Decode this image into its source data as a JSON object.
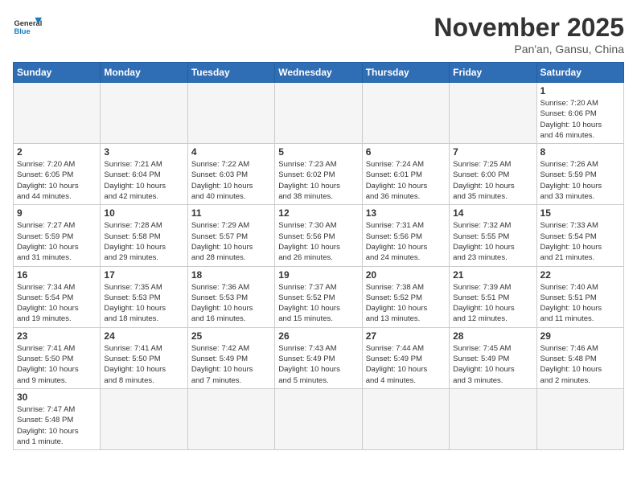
{
  "logo": {
    "general": "General",
    "blue": "Blue"
  },
  "title": "November 2025",
  "location": "Pan'an, Gansu, China",
  "weekdays": [
    "Sunday",
    "Monday",
    "Tuesday",
    "Wednesday",
    "Thursday",
    "Friday",
    "Saturday"
  ],
  "weeks": [
    [
      {
        "day": "",
        "info": ""
      },
      {
        "day": "",
        "info": ""
      },
      {
        "day": "",
        "info": ""
      },
      {
        "day": "",
        "info": ""
      },
      {
        "day": "",
        "info": ""
      },
      {
        "day": "",
        "info": ""
      },
      {
        "day": "1",
        "info": "Sunrise: 7:20 AM\nSunset: 6:06 PM\nDaylight: 10 hours\nand 46 minutes."
      }
    ],
    [
      {
        "day": "2",
        "info": "Sunrise: 7:20 AM\nSunset: 6:05 PM\nDaylight: 10 hours\nand 44 minutes."
      },
      {
        "day": "3",
        "info": "Sunrise: 7:21 AM\nSunset: 6:04 PM\nDaylight: 10 hours\nand 42 minutes."
      },
      {
        "day": "4",
        "info": "Sunrise: 7:22 AM\nSunset: 6:03 PM\nDaylight: 10 hours\nand 40 minutes."
      },
      {
        "day": "5",
        "info": "Sunrise: 7:23 AM\nSunset: 6:02 PM\nDaylight: 10 hours\nand 38 minutes."
      },
      {
        "day": "6",
        "info": "Sunrise: 7:24 AM\nSunset: 6:01 PM\nDaylight: 10 hours\nand 36 minutes."
      },
      {
        "day": "7",
        "info": "Sunrise: 7:25 AM\nSunset: 6:00 PM\nDaylight: 10 hours\nand 35 minutes."
      },
      {
        "day": "8",
        "info": "Sunrise: 7:26 AM\nSunset: 5:59 PM\nDaylight: 10 hours\nand 33 minutes."
      }
    ],
    [
      {
        "day": "9",
        "info": "Sunrise: 7:27 AM\nSunset: 5:59 PM\nDaylight: 10 hours\nand 31 minutes."
      },
      {
        "day": "10",
        "info": "Sunrise: 7:28 AM\nSunset: 5:58 PM\nDaylight: 10 hours\nand 29 minutes."
      },
      {
        "day": "11",
        "info": "Sunrise: 7:29 AM\nSunset: 5:57 PM\nDaylight: 10 hours\nand 28 minutes."
      },
      {
        "day": "12",
        "info": "Sunrise: 7:30 AM\nSunset: 5:56 PM\nDaylight: 10 hours\nand 26 minutes."
      },
      {
        "day": "13",
        "info": "Sunrise: 7:31 AM\nSunset: 5:56 PM\nDaylight: 10 hours\nand 24 minutes."
      },
      {
        "day": "14",
        "info": "Sunrise: 7:32 AM\nSunset: 5:55 PM\nDaylight: 10 hours\nand 23 minutes."
      },
      {
        "day": "15",
        "info": "Sunrise: 7:33 AM\nSunset: 5:54 PM\nDaylight: 10 hours\nand 21 minutes."
      }
    ],
    [
      {
        "day": "16",
        "info": "Sunrise: 7:34 AM\nSunset: 5:54 PM\nDaylight: 10 hours\nand 19 minutes."
      },
      {
        "day": "17",
        "info": "Sunrise: 7:35 AM\nSunset: 5:53 PM\nDaylight: 10 hours\nand 18 minutes."
      },
      {
        "day": "18",
        "info": "Sunrise: 7:36 AM\nSunset: 5:53 PM\nDaylight: 10 hours\nand 16 minutes."
      },
      {
        "day": "19",
        "info": "Sunrise: 7:37 AM\nSunset: 5:52 PM\nDaylight: 10 hours\nand 15 minutes."
      },
      {
        "day": "20",
        "info": "Sunrise: 7:38 AM\nSunset: 5:52 PM\nDaylight: 10 hours\nand 13 minutes."
      },
      {
        "day": "21",
        "info": "Sunrise: 7:39 AM\nSunset: 5:51 PM\nDaylight: 10 hours\nand 12 minutes."
      },
      {
        "day": "22",
        "info": "Sunrise: 7:40 AM\nSunset: 5:51 PM\nDaylight: 10 hours\nand 11 minutes."
      }
    ],
    [
      {
        "day": "23",
        "info": "Sunrise: 7:41 AM\nSunset: 5:50 PM\nDaylight: 10 hours\nand 9 minutes."
      },
      {
        "day": "24",
        "info": "Sunrise: 7:41 AM\nSunset: 5:50 PM\nDaylight: 10 hours\nand 8 minutes."
      },
      {
        "day": "25",
        "info": "Sunrise: 7:42 AM\nSunset: 5:49 PM\nDaylight: 10 hours\nand 7 minutes."
      },
      {
        "day": "26",
        "info": "Sunrise: 7:43 AM\nSunset: 5:49 PM\nDaylight: 10 hours\nand 5 minutes."
      },
      {
        "day": "27",
        "info": "Sunrise: 7:44 AM\nSunset: 5:49 PM\nDaylight: 10 hours\nand 4 minutes."
      },
      {
        "day": "28",
        "info": "Sunrise: 7:45 AM\nSunset: 5:49 PM\nDaylight: 10 hours\nand 3 minutes."
      },
      {
        "day": "29",
        "info": "Sunrise: 7:46 AM\nSunset: 5:48 PM\nDaylight: 10 hours\nand 2 minutes."
      }
    ],
    [
      {
        "day": "30",
        "info": "Sunrise: 7:47 AM\nSunset: 5:48 PM\nDaylight: 10 hours\nand 1 minute."
      },
      {
        "day": "",
        "info": ""
      },
      {
        "day": "",
        "info": ""
      },
      {
        "day": "",
        "info": ""
      },
      {
        "day": "",
        "info": ""
      },
      {
        "day": "",
        "info": ""
      },
      {
        "day": "",
        "info": ""
      }
    ]
  ]
}
